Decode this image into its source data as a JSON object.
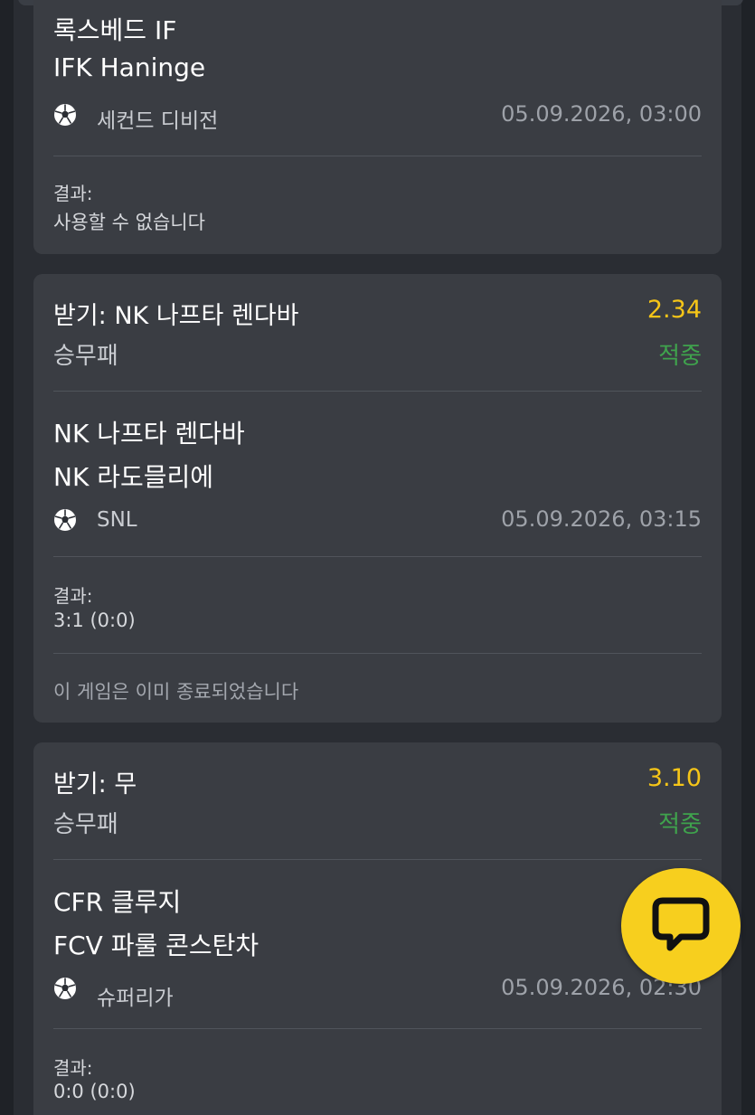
{
  "cards": [
    {
      "team1": "록스베드 IF",
      "team2": "IFK Haninge",
      "league": "세컨드 디비전",
      "date": "05.09.2026, 03:00",
      "result_label": "결과:",
      "result_value": "사용할 수 없습니다"
    },
    {
      "bet": "받기: NK 나프타 렌다바",
      "odds": "2.34",
      "market": "승무패",
      "status": "적중",
      "team1": "NK 나프타 렌다바",
      "team2": "NK 라도믈리에",
      "league": "SNL",
      "date": "05.09.2026, 03:15",
      "result_label": "결과:",
      "result_value": "3:1 (0:0)",
      "notice": "이 게임은 이미 종료되었습니다"
    },
    {
      "bet": "받기: 무",
      "odds": "3.10",
      "market": "승무패",
      "status": "적중",
      "team1": "CFR 클루지",
      "team2": "FCV 파룰 콘스탄차",
      "league": "슈퍼리가",
      "date": "05.09.2026, 02:30",
      "result_label": "결과:",
      "result_value": "0:0 (0:0)"
    }
  ],
  "icons": {
    "sport": "soccer-ball-icon",
    "chat": "chat-bubble-icon"
  },
  "colors": {
    "odds": "#f5c518",
    "status_win": "#3fa34d",
    "chat_button": "#f7cf1e"
  }
}
